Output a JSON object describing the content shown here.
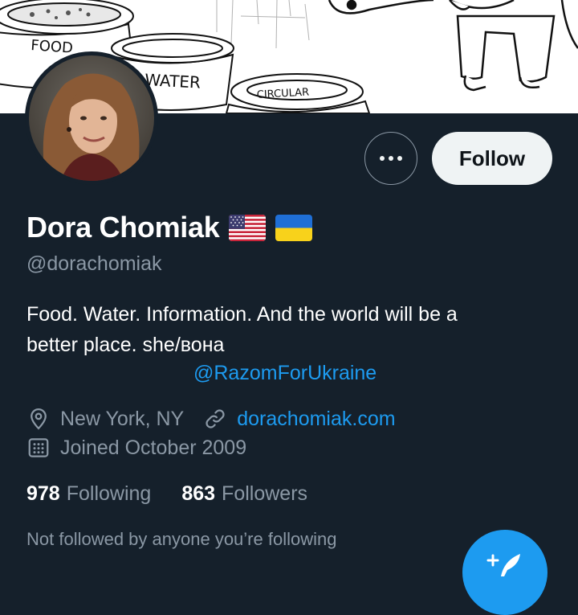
{
  "banner": {
    "bowls": [
      {
        "label": "FOOD"
      },
      {
        "label": "WATER"
      },
      {
        "label": "CIRCULAR"
      }
    ]
  },
  "header": {
    "more_icon": "more-dots-icon",
    "follow_label": "Follow"
  },
  "profile": {
    "name": "Dora Chomiak",
    "flags": [
      "us-flag",
      "ukraine-flag"
    ],
    "handle": "@dorachomiak",
    "bio_line1": "Food. Water. Information. And the world will be a",
    "bio_line2": "better place. she/вона",
    "bio_link": "@RazomForUkraine",
    "location": "New York, NY",
    "website": "dorachomiak.com",
    "joined": "Joined October 2009"
  },
  "stats": {
    "following_count": "978",
    "following_label": "Following",
    "followers_count": "863",
    "followers_label": "Followers"
  },
  "social_context": "Not followed by anyone you’re following",
  "compose": {
    "icon": "compose-tweet-icon"
  },
  "colors": {
    "background": "#15202b",
    "accent": "#1d9bf0",
    "muted": "#8b98a5",
    "follow_button": "#eff3f4"
  }
}
